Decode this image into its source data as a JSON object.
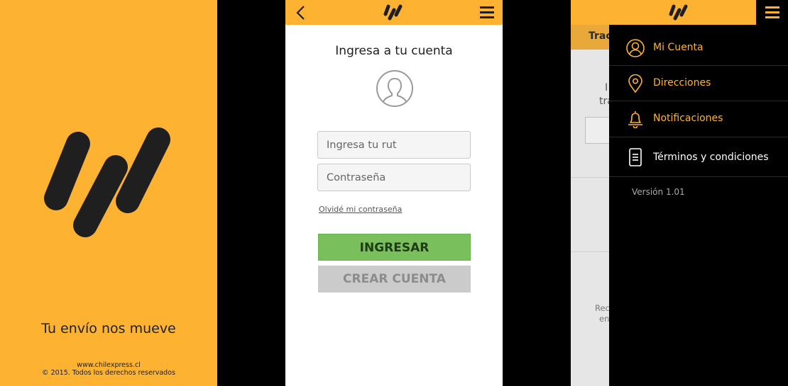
{
  "colors": {
    "brand_yellow": "#fdb331",
    "login_green": "#79bf5c",
    "create_gray": "#cbcbcb",
    "drawer_black": "#000000"
  },
  "splash": {
    "tagline": "Tu envío nos mueve",
    "website": "www.chilexpress.cl",
    "copyright": "© 2015. Todos los derechos reservados"
  },
  "login": {
    "header": {
      "back_icon": "chevron-left-icon",
      "logo_icon": "chilexpress-logo",
      "menu_icon": "hamburger-icon"
    },
    "title": "Ingresa a tu cuenta",
    "avatar_icon": "user-avatar-icon",
    "rut_placeholder": "Ingresa tu rut",
    "password_placeholder": "Contraseña",
    "forgot_password": "Olvidé mi contraseña",
    "login_button": "INGRESAR",
    "create_account_button": "CREAR CUENTA"
  },
  "menu_screen": {
    "background": {
      "tab_label": "Track",
      "text_line1": "I",
      "text_line2": "tra",
      "text_line3": "Rec",
      "text_line4": "en"
    },
    "drawer": {
      "items": [
        {
          "label": "Mi Cuenta",
          "icon": "user-icon"
        },
        {
          "label": "Direcciones",
          "icon": "map-pin-icon"
        },
        {
          "label": "Notificaciones",
          "icon": "bell-icon"
        },
        {
          "label": "Términos y condiciones",
          "icon": "document-icon"
        }
      ],
      "version": "Versión 1.01"
    }
  }
}
